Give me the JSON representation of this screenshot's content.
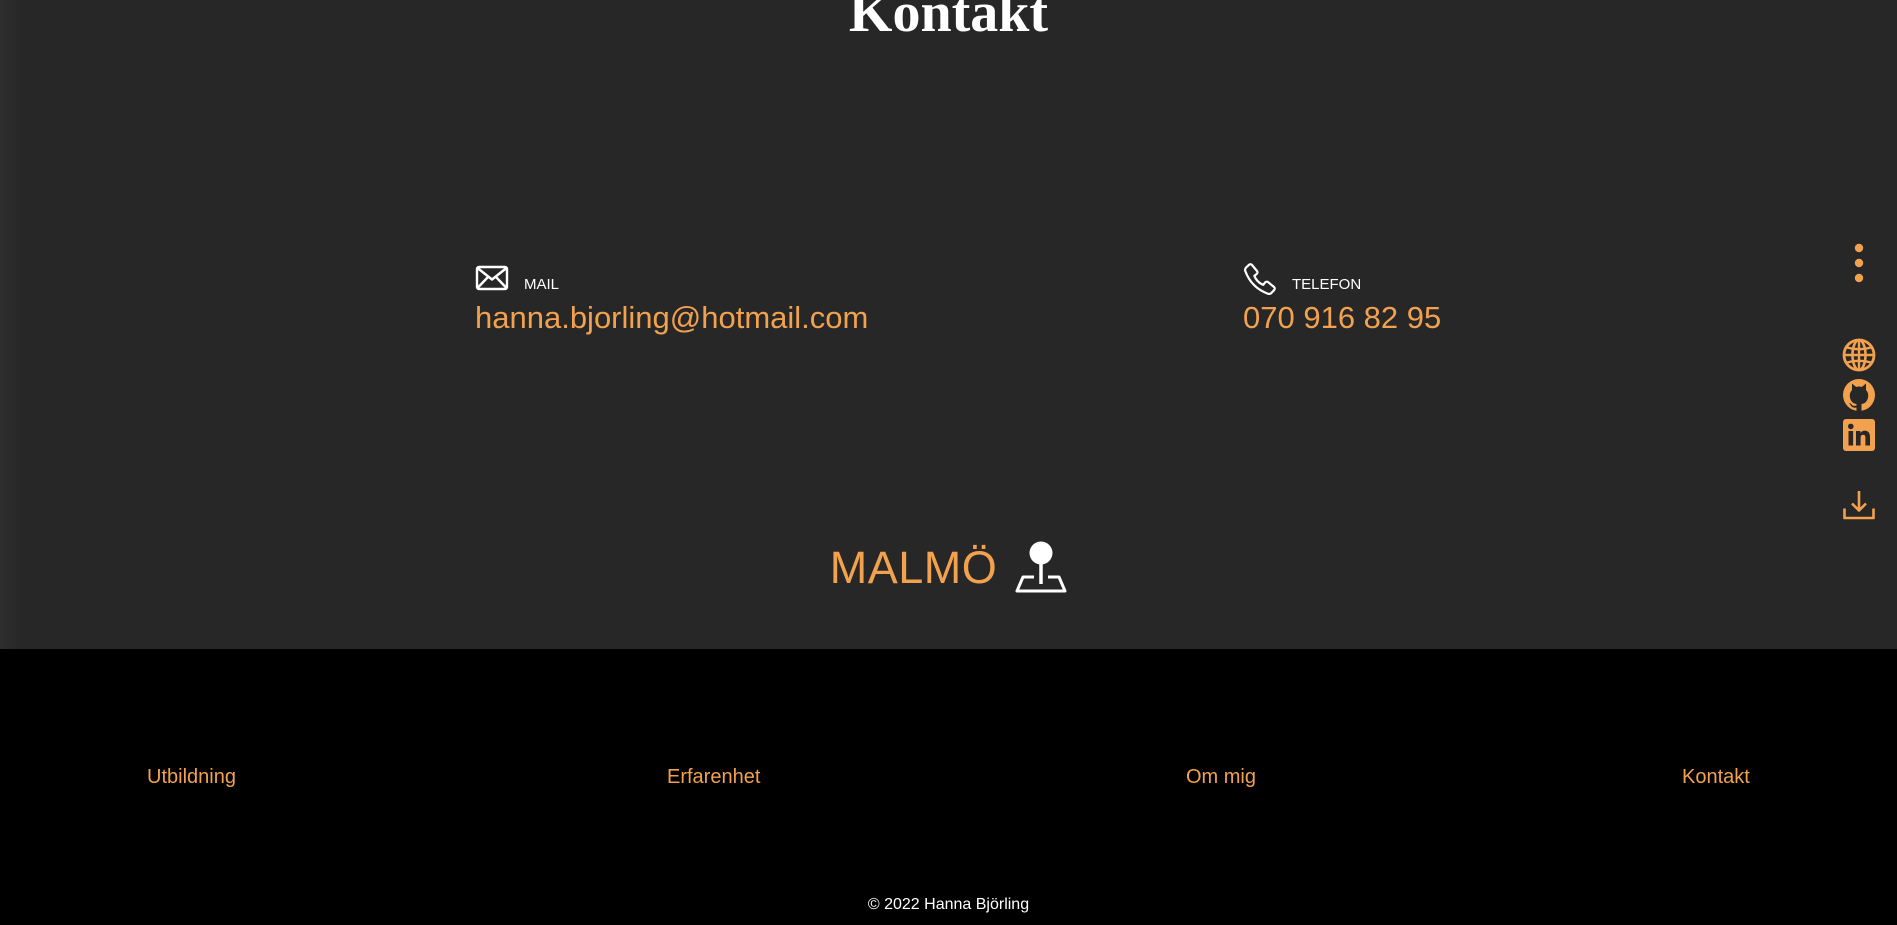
{
  "contact": {
    "title": "Kontakt",
    "mail": {
      "icon": "envelope-icon",
      "label": "MAIL",
      "value": "hanna.bjorling@hotmail.com"
    },
    "phone": {
      "icon": "phone-icon",
      "label": "TELEFON",
      "value": "070 916 82 95"
    },
    "location": {
      "city": "MALMÖ",
      "icon": "map-pin-icon"
    }
  },
  "side_rail": {
    "items": [
      {
        "icon": "more-vertical-icon"
      },
      {
        "icon": "globe-icon"
      },
      {
        "icon": "github-icon"
      },
      {
        "icon": "linkedin-icon"
      },
      {
        "icon": "download-icon"
      }
    ]
  },
  "footer": {
    "nav": [
      {
        "label": "Utbildning"
      },
      {
        "label": "Erfarenhet"
      },
      {
        "label": "Om mig"
      },
      {
        "label": "Kontakt"
      }
    ],
    "copyright": "© 2022 Hanna Björling"
  },
  "colors": {
    "background": "#272727",
    "footer_background": "#000000",
    "accent": "#f2a24e",
    "text": "#ffffff"
  }
}
